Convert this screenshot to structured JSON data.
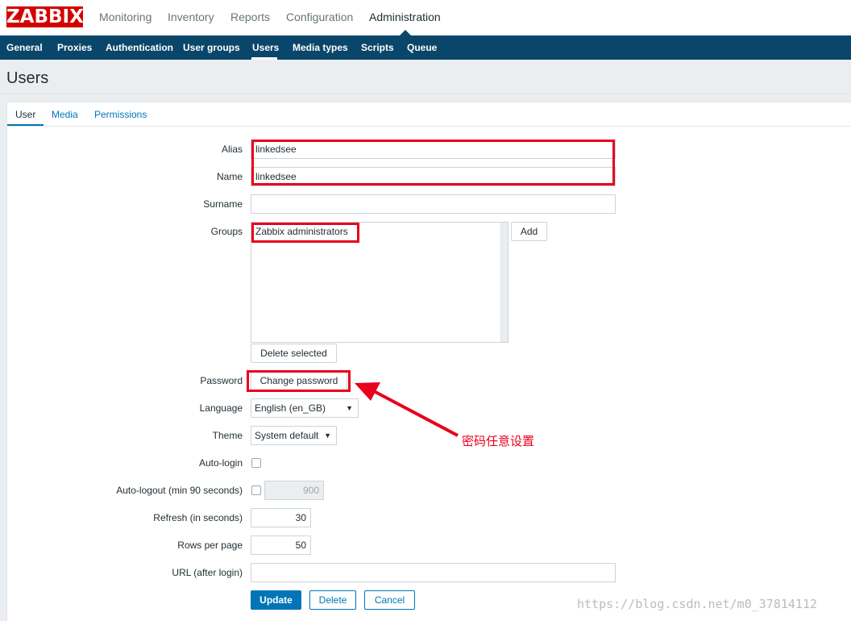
{
  "app": {
    "logo": "ZABBIX",
    "top_menu": [
      "Monitoring",
      "Inventory",
      "Reports",
      "Configuration",
      "Administration"
    ],
    "top_menu_active": "Administration",
    "sub_menu": [
      "General",
      "Proxies",
      "Authentication",
      "User groups",
      "Users",
      "Media types",
      "Scripts",
      "Queue"
    ],
    "sub_menu_active": "Users"
  },
  "page": {
    "title": "Users",
    "tabs": [
      "User",
      "Media",
      "Permissions"
    ],
    "active_tab": "User"
  },
  "form": {
    "alias": {
      "label": "Alias",
      "value": "linkedsee"
    },
    "name": {
      "label": "Name",
      "value": "linkedsee"
    },
    "surname": {
      "label": "Surname",
      "value": ""
    },
    "groups": {
      "label": "Groups",
      "items": [
        "Zabbix administrators"
      ],
      "add_label": "Add",
      "delete_label": "Delete selected"
    },
    "password": {
      "label": "Password",
      "button_label": "Change password"
    },
    "language": {
      "label": "Language",
      "value": "English (en_GB)"
    },
    "theme": {
      "label": "Theme",
      "value": "System default"
    },
    "autologin": {
      "label": "Auto-login",
      "checked": false
    },
    "autologout": {
      "label": "Auto-logout (min 90 seconds)",
      "checked": false,
      "value": "900"
    },
    "refresh": {
      "label": "Refresh (in seconds)",
      "value": "30"
    },
    "rows_per_page": {
      "label": "Rows per page",
      "value": "50"
    },
    "url": {
      "label": "URL (after login)",
      "value": ""
    },
    "actions": {
      "update": "Update",
      "delete": "Delete",
      "cancel": "Cancel"
    }
  },
  "annotation": {
    "text": "密码任意设置",
    "color": "#e8001c"
  },
  "watermark": "https://blog.csdn.net/m0_37814112",
  "colors": {
    "brand_red": "#d40000",
    "nav_dark": "#0a466a",
    "accent_blue": "#0275b8"
  }
}
